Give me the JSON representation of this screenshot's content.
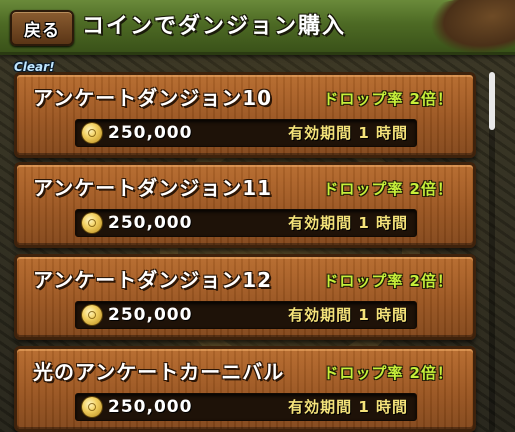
{
  "header": {
    "back_label": "戻る",
    "title": "コインでダンジョン購入"
  },
  "cleared_badge": "Clear!",
  "dungeons": [
    {
      "name": "アンケートダンジョン10",
      "bonus": "ドロップ率 2倍！",
      "price": "250,000",
      "duration": "有効期間 1 時間",
      "cleared": true
    },
    {
      "name": "アンケートダンジョン11",
      "bonus": "ドロップ率 2倍！",
      "price": "250,000",
      "duration": "有効期間 1 時間",
      "cleared": false
    },
    {
      "name": "アンケートダンジョン12",
      "bonus": "ドロップ率 2倍！",
      "price": "250,000",
      "duration": "有効期間 1 時間",
      "cleared": false
    },
    {
      "name": "光のアンケートカーニバル",
      "bonus": "ドロップ率 2倍！",
      "price": "250,000",
      "duration": "有効期間 1 時間",
      "cleared": false
    }
  ],
  "icons": {
    "currency": "coin-icon"
  },
  "colors": {
    "header": "#4d6a24",
    "card": "#9a5520",
    "bonus_text": "#c6ef3a",
    "duration_text": "#f4e27a"
  },
  "scroll": {
    "position": 0
  }
}
